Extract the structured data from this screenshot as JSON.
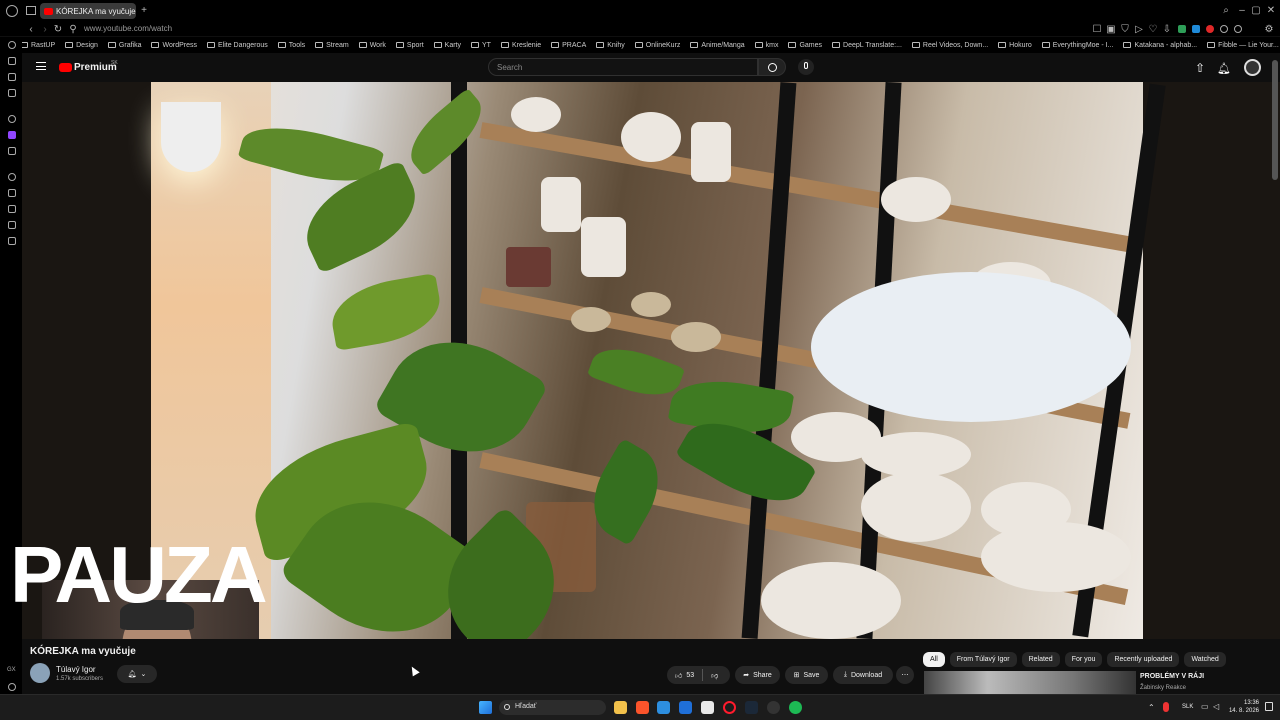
{
  "browser": {
    "tab_title": "KÓREJKA ma vyučuje",
    "url": "www.youtube.com/watch",
    "bookmarks": [
      "RastUP",
      "Design",
      "Grafika",
      "WordPress",
      "Elite Dangerous",
      "Tools",
      "Stream",
      "Work",
      "Sport",
      "Karty",
      "YT",
      "Kreslenie",
      "PRACA",
      "Knihy",
      "OnlineKurz",
      "Anime/Manga",
      "kmx",
      "Games",
      "DeepL Translate:...",
      "Reel Videos, Down...",
      "Hokuro",
      "EverythingMoe - I...",
      "Katakana - alphab...",
      "Fibble — Lie Your...",
      "Artists - Official W..."
    ]
  },
  "youtube": {
    "logo": "Premium",
    "region": "SK",
    "search_placeholder": "Search"
  },
  "overlay": {
    "text": "PAUZA"
  },
  "video": {
    "title": "KÓREJKA ma vyučuje",
    "channel": "Túlavý Igor",
    "subscribers": "1.57k subscribers",
    "likes": "53",
    "share": "Share",
    "save": "Save",
    "download": "Download"
  },
  "chips": [
    "All",
    "From Túlavý Igor",
    "Related",
    "For you",
    "Recently uploaded",
    "Watched"
  ],
  "recommendation": {
    "title": "PROBLÉMY V RÁJI",
    "channel": "Žabinsky Reakce"
  },
  "taskbar": {
    "search": "Hľadať",
    "lang": "SLK",
    "time": "13:36",
    "date": "14. 8. 2026"
  },
  "colors": {
    "accent": "#ff0000",
    "background": "#0f0f0f",
    "pill": "#272727"
  }
}
